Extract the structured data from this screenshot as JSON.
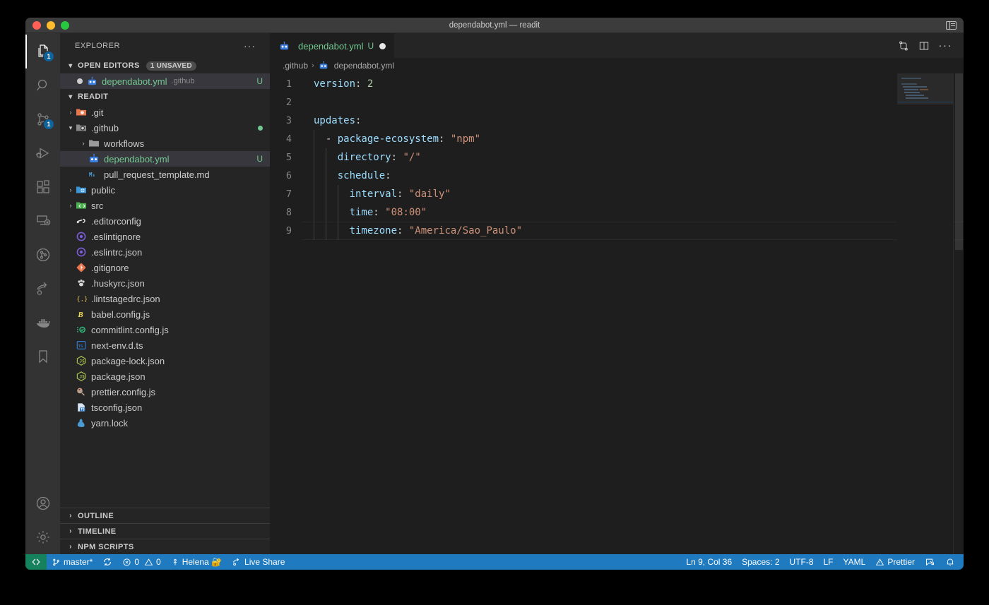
{
  "window": {
    "title": "dependabot.yml — readit",
    "traffic_lights": [
      "close",
      "minimize",
      "zoom"
    ],
    "layout_toggle_icon": "customize-layout-icon"
  },
  "activity_bar": {
    "items": [
      {
        "name": "explorer",
        "icon": "files-icon",
        "active": true,
        "badge": "1"
      },
      {
        "name": "search",
        "icon": "search-icon",
        "active": false,
        "badge": ""
      },
      {
        "name": "source-control",
        "icon": "source-control-icon",
        "active": false,
        "badge": "1"
      },
      {
        "name": "run-and-debug",
        "icon": "run-debug-icon",
        "active": false,
        "badge": ""
      },
      {
        "name": "extensions",
        "icon": "extensions-icon",
        "active": false,
        "badge": ""
      },
      {
        "name": "remote-explorer",
        "icon": "remote-explorer-icon",
        "active": false,
        "badge": ""
      },
      {
        "name": "gitlens",
        "icon": "gitlens-icon",
        "active": false,
        "badge": ""
      },
      {
        "name": "live-share",
        "icon": "live-share-icon",
        "active": false,
        "badge": ""
      },
      {
        "name": "docker",
        "icon": "docker-icon",
        "active": false,
        "badge": ""
      },
      {
        "name": "bookmarks",
        "icon": "bookmark-icon",
        "active": false,
        "badge": ""
      }
    ],
    "bottom_items": [
      {
        "name": "accounts",
        "icon": "account-icon"
      },
      {
        "name": "settings",
        "icon": "gear-icon"
      }
    ]
  },
  "sidebar": {
    "title": "EXPLORER",
    "more_actions": "···",
    "open_editors": {
      "label": "OPEN EDITORS",
      "badge": "1 UNSAVED",
      "twisty": "▾",
      "items": [
        {
          "name": "dependabot.yml",
          "description": ".github",
          "flag": "U",
          "dirty": true,
          "icon": "dependabot-icon",
          "selected": true
        }
      ]
    },
    "project": {
      "label": "READIT",
      "twisty": "▾",
      "tree": [
        {
          "label": ".git",
          "type": "folder",
          "depth": 0,
          "expanded": false,
          "icon": "folder-git-icon",
          "flag": "",
          "modified": false,
          "selected": false
        },
        {
          "label": ".github",
          "type": "folder",
          "depth": 0,
          "expanded": true,
          "icon": "folder-github-icon",
          "flag": "",
          "modified": true,
          "selected": false
        },
        {
          "label": "workflows",
          "type": "folder",
          "depth": 1,
          "expanded": false,
          "icon": "folder-icon",
          "flag": "",
          "modified": false,
          "selected": false
        },
        {
          "label": "dependabot.yml",
          "type": "file",
          "depth": 1,
          "expanded": false,
          "icon": "dependabot-icon",
          "flag": "U",
          "modified": false,
          "selected": true
        },
        {
          "label": "pull_request_template.md",
          "type": "file",
          "depth": 1,
          "expanded": false,
          "icon": "markdown-icon",
          "flag": "",
          "modified": false,
          "selected": false
        },
        {
          "label": "public",
          "type": "folder",
          "depth": 0,
          "expanded": false,
          "icon": "folder-public-icon",
          "flag": "",
          "modified": false,
          "selected": false
        },
        {
          "label": "src",
          "type": "folder",
          "depth": 0,
          "expanded": false,
          "icon": "folder-src-icon",
          "flag": "",
          "modified": false,
          "selected": false
        },
        {
          "label": ".editorconfig",
          "type": "file",
          "depth": 0,
          "expanded": false,
          "icon": "editorconfig-icon",
          "flag": "",
          "modified": false,
          "selected": false
        },
        {
          "label": ".eslintignore",
          "type": "file",
          "depth": 0,
          "expanded": false,
          "icon": "eslint-icon",
          "flag": "",
          "modified": false,
          "selected": false
        },
        {
          "label": ".eslintrc.json",
          "type": "file",
          "depth": 0,
          "expanded": false,
          "icon": "eslint-icon",
          "flag": "",
          "modified": false,
          "selected": false
        },
        {
          "label": ".gitignore",
          "type": "file",
          "depth": 0,
          "expanded": false,
          "icon": "git-icon",
          "flag": "",
          "modified": false,
          "selected": false
        },
        {
          "label": ".huskyrc.json",
          "type": "file",
          "depth": 0,
          "expanded": false,
          "icon": "husky-icon",
          "flag": "",
          "modified": false,
          "selected": false
        },
        {
          "label": ".lintstagedrc.json",
          "type": "file",
          "depth": 0,
          "expanded": false,
          "icon": "json-braces-icon",
          "flag": "",
          "modified": false,
          "selected": false
        },
        {
          "label": "babel.config.js",
          "type": "file",
          "depth": 0,
          "expanded": false,
          "icon": "babel-icon",
          "flag": "",
          "modified": false,
          "selected": false
        },
        {
          "label": "commitlint.config.js",
          "type": "file",
          "depth": 0,
          "expanded": false,
          "icon": "commitlint-icon",
          "flag": "",
          "modified": false,
          "selected": false
        },
        {
          "label": "next-env.d.ts",
          "type": "file",
          "depth": 0,
          "expanded": false,
          "icon": "typescript-def-icon",
          "flag": "",
          "modified": false,
          "selected": false
        },
        {
          "label": "package-lock.json",
          "type": "file",
          "depth": 0,
          "expanded": false,
          "icon": "npm-icon",
          "flag": "",
          "modified": false,
          "selected": false
        },
        {
          "label": "package.json",
          "type": "file",
          "depth": 0,
          "expanded": false,
          "icon": "npm-icon",
          "flag": "",
          "modified": false,
          "selected": false
        },
        {
          "label": "prettier.config.js",
          "type": "file",
          "depth": 0,
          "expanded": false,
          "icon": "prettier-icon",
          "flag": "",
          "modified": false,
          "selected": false
        },
        {
          "label": "tsconfig.json",
          "type": "file",
          "depth": 0,
          "expanded": false,
          "icon": "tsconfig-icon",
          "flag": "",
          "modified": false,
          "selected": false
        },
        {
          "label": "yarn.lock",
          "type": "file",
          "depth": 0,
          "expanded": false,
          "icon": "yarn-icon",
          "flag": "",
          "modified": false,
          "selected": false
        }
      ]
    },
    "bottom_panels": [
      {
        "label": "OUTLINE",
        "twisty": "›"
      },
      {
        "label": "TIMELINE",
        "twisty": "›"
      },
      {
        "label": "NPM SCRIPTS",
        "twisty": "›"
      }
    ]
  },
  "editor": {
    "tab": {
      "label": "dependabot.yml",
      "flag": "U",
      "dirty": true,
      "icon": "dependabot-icon"
    },
    "actions": [
      {
        "name": "open-changes",
        "icon": "compare-changes-icon"
      },
      {
        "name": "split-editor",
        "icon": "split-editor-icon"
      },
      {
        "name": "more-actions",
        "icon": "ellipsis-icon"
      }
    ],
    "breadcrumb": [
      {
        "label": ".github",
        "icon": ""
      },
      {
        "label": "dependabot.yml",
        "icon": "dependabot-icon"
      }
    ],
    "language": "yaml",
    "lines": [
      {
        "no": "1",
        "indent": 0,
        "tokens": [
          {
            "t": "k",
            "v": "version"
          },
          {
            "t": "p",
            "v": ": "
          },
          {
            "t": "n",
            "v": "2"
          }
        ]
      },
      {
        "no": "2",
        "indent": 0,
        "tokens": []
      },
      {
        "no": "3",
        "indent": 0,
        "tokens": [
          {
            "t": "k",
            "v": "updates"
          },
          {
            "t": "p",
            "v": ":"
          }
        ]
      },
      {
        "no": "4",
        "indent": 1,
        "tokens": [
          {
            "t": "p",
            "v": "  - "
          },
          {
            "t": "k",
            "v": "package-ecosystem"
          },
          {
            "t": "p",
            "v": ": "
          },
          {
            "t": "s",
            "v": "\"npm\""
          }
        ]
      },
      {
        "no": "5",
        "indent": 2,
        "tokens": [
          {
            "t": "p",
            "v": "    "
          },
          {
            "t": "k",
            "v": "directory"
          },
          {
            "t": "p",
            "v": ": "
          },
          {
            "t": "s",
            "v": "\"/\""
          }
        ]
      },
      {
        "no": "6",
        "indent": 2,
        "tokens": [
          {
            "t": "p",
            "v": "    "
          },
          {
            "t": "k",
            "v": "schedule"
          },
          {
            "t": "p",
            "v": ":"
          }
        ]
      },
      {
        "no": "7",
        "indent": 3,
        "tokens": [
          {
            "t": "p",
            "v": "      "
          },
          {
            "t": "k",
            "v": "interval"
          },
          {
            "t": "p",
            "v": ": "
          },
          {
            "t": "s",
            "v": "\"daily\""
          }
        ]
      },
      {
        "no": "8",
        "indent": 3,
        "tokens": [
          {
            "t": "p",
            "v": "      "
          },
          {
            "t": "k",
            "v": "time"
          },
          {
            "t": "p",
            "v": ": "
          },
          {
            "t": "s",
            "v": "\"08:00\""
          }
        ]
      },
      {
        "no": "9",
        "indent": 3,
        "current": true,
        "tokens": [
          {
            "t": "p",
            "v": "      "
          },
          {
            "t": "k",
            "v": "timezone"
          },
          {
            "t": "p",
            "v": ": "
          },
          {
            "t": "s",
            "v": "\"America/Sao_Paulo\""
          }
        ]
      }
    ]
  },
  "status_bar": {
    "remote": {
      "label": "",
      "icon": "remote-window-icon"
    },
    "left": [
      {
        "name": "git-branch",
        "icon": "branch-icon",
        "label": "master*"
      },
      {
        "name": "sync-changes",
        "icon": "sync-icon",
        "label": ""
      },
      {
        "name": "problems",
        "icon": "error-warning-icon",
        "label": "0  0",
        "errors": "0",
        "warnings": "0"
      },
      {
        "name": "live-share-session",
        "icon": "person-icon",
        "label": "Helena 🔐"
      },
      {
        "name": "live-share",
        "icon": "live-share-icon",
        "label": "Live Share"
      }
    ],
    "right": [
      {
        "name": "cursor-position",
        "label": "Ln 9, Col 36"
      },
      {
        "name": "indentation",
        "label": "Spaces: 2"
      },
      {
        "name": "encoding",
        "label": "UTF-8"
      },
      {
        "name": "eol",
        "label": "LF"
      },
      {
        "name": "language-mode",
        "label": "YAML"
      },
      {
        "name": "prettier",
        "label": "Prettier",
        "icon": "warning-icon"
      },
      {
        "name": "feedback",
        "label": "",
        "icon": "feedback-icon"
      },
      {
        "name": "notifications",
        "label": "",
        "icon": "bell-icon"
      }
    ]
  },
  "colors": {
    "accent": "#1f7ac0",
    "remote_green": "#16825d",
    "editor_bg": "#1e1e1e",
    "sidebar_bg": "#252526",
    "activitybar_bg": "#333333",
    "string": "#ce9178",
    "key": "#9cdcfe",
    "number": "#b5cea8",
    "green_text": "#73c991"
  }
}
